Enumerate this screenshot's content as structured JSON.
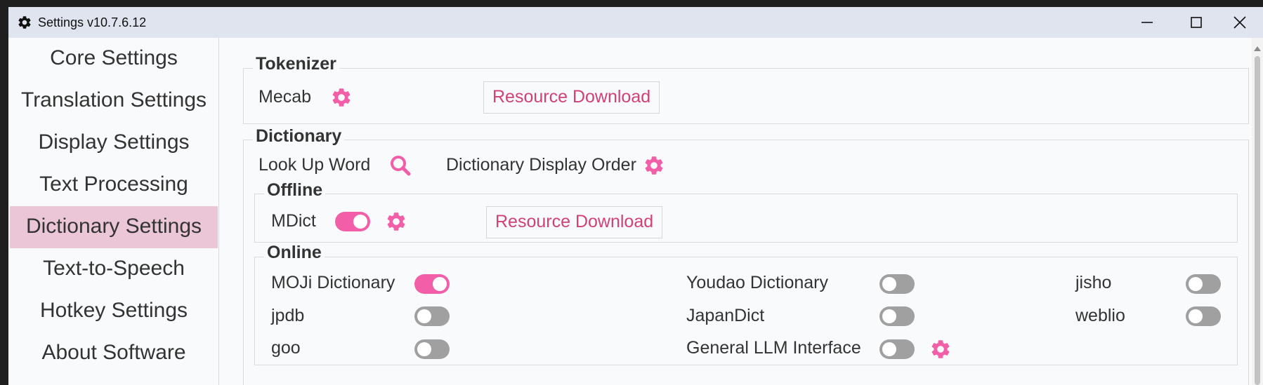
{
  "window": {
    "title": "Settings v10.7.6.12"
  },
  "sidebar": {
    "items": [
      {
        "label": "Core Settings"
      },
      {
        "label": "Translation Settings"
      },
      {
        "label": "Display Settings"
      },
      {
        "label": "Text Processing"
      },
      {
        "label": "Dictionary Settings",
        "active": true
      },
      {
        "label": "Text-to-Speech"
      },
      {
        "label": "Hotkey Settings"
      },
      {
        "label": "About Software"
      }
    ]
  },
  "tokenizer": {
    "title": "Tokenizer",
    "mecab_label": "Mecab",
    "resource_download": "Resource Download"
  },
  "dictionary": {
    "title": "Dictionary",
    "look_up_word": "Look Up Word",
    "display_order": "Dictionary Display Order",
    "offline": {
      "title": "Offline",
      "mdict_label": "MDict",
      "mdict_enabled": true,
      "resource_download": "Resource Download"
    },
    "online": {
      "title": "Online",
      "items": [
        {
          "label": "MOJi Dictionary",
          "enabled": true
        },
        {
          "label": "Youdao Dictionary",
          "enabled": false
        },
        {
          "label": "jisho",
          "enabled": false
        },
        {
          "label": "jpdb",
          "enabled": false
        },
        {
          "label": "JapanDict",
          "enabled": false
        },
        {
          "label": "weblio",
          "enabled": false
        },
        {
          "label": "goo",
          "enabled": false
        },
        {
          "label": "General LLM Interface",
          "enabled": false
        }
      ]
    }
  },
  "colors": {
    "accent": "#f25ea8",
    "link_text": "#d0417a",
    "active_nav": "#ebc6d6",
    "toggle_off": "#a0a0a0"
  },
  "icons": {
    "title": "gear-icon",
    "settings": "gear-icon",
    "lookup": "search-icon"
  }
}
